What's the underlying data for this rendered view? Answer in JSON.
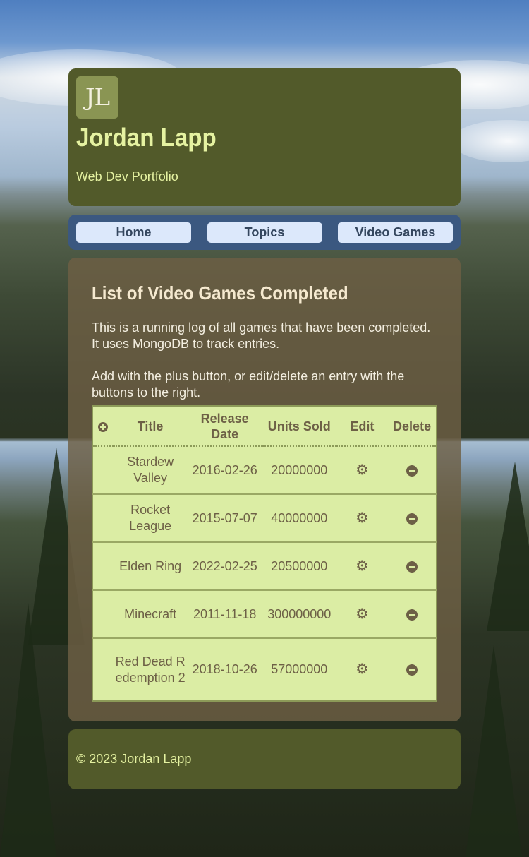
{
  "header": {
    "logo_text": "JL",
    "title": "Jordan Lapp",
    "tagline": "Web Dev Portfolio"
  },
  "nav": {
    "items": [
      {
        "label": "Home"
      },
      {
        "label": "Topics"
      },
      {
        "label": "Video Games"
      }
    ]
  },
  "main": {
    "heading": "List of Video Games Completed",
    "paragraph1": "This is a running log of all games that have been completed. It uses MongoDB to track entries.",
    "paragraph2": "Add with the plus button, or edit/delete an entry with the buttons to the right.",
    "table": {
      "headers": {
        "title": "Title",
        "release_date": "Release Date",
        "units_sold": "Units Sold",
        "edit": "Edit",
        "delete": "Delete"
      },
      "rows": [
        {
          "title": "Stardew Valley",
          "release_date": "2016-02-26",
          "units_sold": "20000000"
        },
        {
          "title": "Rocket League",
          "release_date": "2015-07-07",
          "units_sold": "40000000"
        },
        {
          "title": "Elden Ring",
          "release_date": "2022-02-25",
          "units_sold": "20500000"
        },
        {
          "title": "Minecraft",
          "release_date": "2011-11-18",
          "units_sold": "300000000"
        },
        {
          "title": "Red Dead Redemption 2",
          "release_date": "2018-10-26",
          "units_sold": "57000000"
        }
      ]
    }
  },
  "footer": {
    "text": "© 2023 Jordan Lapp"
  },
  "colors": {
    "header_bg": "#525a2a",
    "nav_bg": "#3b5880",
    "nav_button_bg": "#dce8fb",
    "table_bg": "#dbeda4",
    "accent_text": "#e5f2a1"
  }
}
